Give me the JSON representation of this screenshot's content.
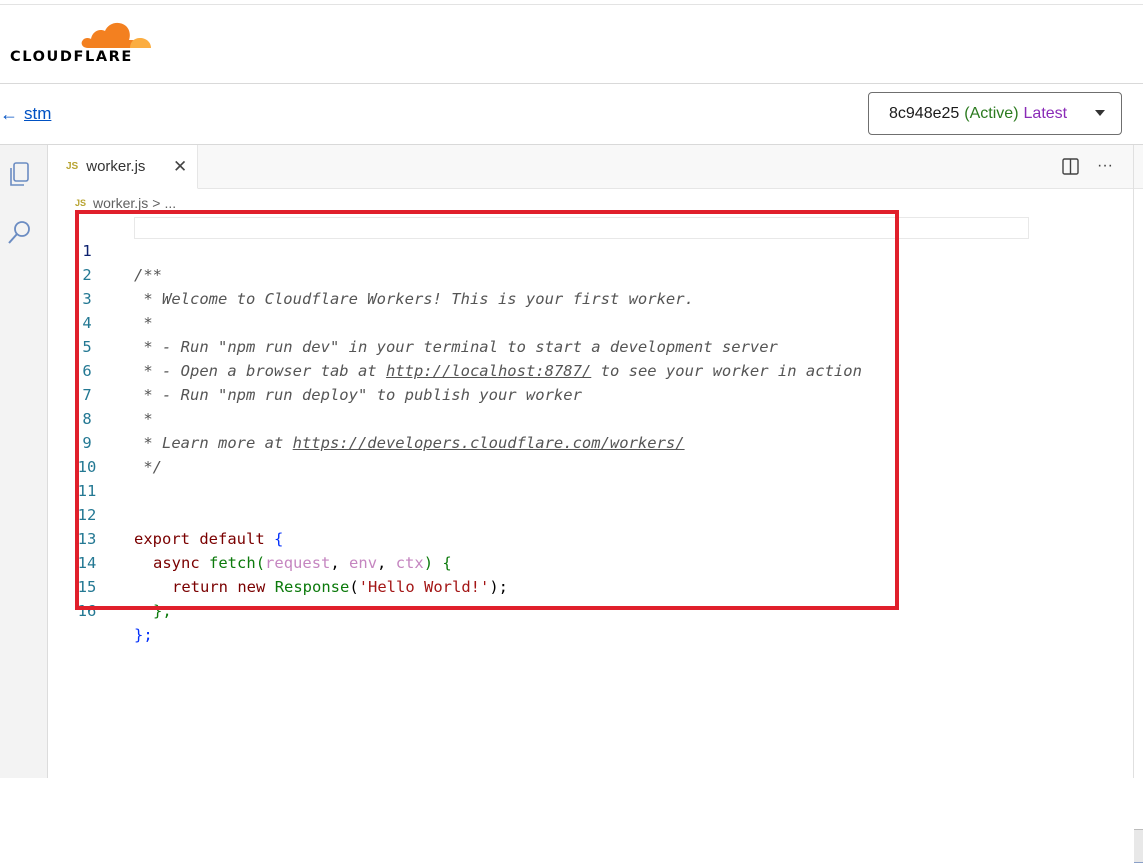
{
  "brand": {
    "name": "CLOUDFLARE"
  },
  "nav": {
    "back_label": "stm",
    "back_icon": "arrow-left-icon"
  },
  "version": {
    "id": "8c948e25",
    "status": "(Active)",
    "tag": "Latest"
  },
  "tabs": [
    {
      "badge": "JS",
      "label": "worker.js"
    }
  ],
  "breadcrumb": {
    "badge": "JS",
    "file": "worker.js",
    "sep": ">",
    "rest": "..."
  },
  "code": {
    "lines": [
      {
        "n": "1",
        "text": "/**"
      },
      {
        "n": "2",
        "text": " * Welcome to Cloudflare Workers! This is your first worker."
      },
      {
        "n": "3",
        "text": " *"
      },
      {
        "n": "4",
        "text": " * - Run \"npm run dev\" in your terminal to start a development server"
      },
      {
        "n": "5",
        "text_pre": " * - Open a browser tab at ",
        "link": "http://localhost:8787/",
        "text_post": " to see your worker in action"
      },
      {
        "n": "6",
        "text": " * - Run \"npm run deploy\" to publish your worker"
      },
      {
        "n": "7",
        "text": " *"
      },
      {
        "n": "8",
        "text_pre": " * Learn more at ",
        "link": "https://developers.cloudflare.com/workers/"
      },
      {
        "n": "9",
        "text": " */"
      },
      {
        "n": "10",
        "text": ""
      },
      {
        "n": "11",
        "text": ""
      },
      {
        "n": "12",
        "kw1": "export",
        "kw2": "default",
        "brace": "{"
      },
      {
        "n": "13",
        "kw": "async",
        "fn": "fetch",
        "p1": "request",
        "p2": "env",
        "p3": "ctx"
      },
      {
        "n": "14",
        "kw1": "return",
        "kw2": "new",
        "type": "Response",
        "str": "'Hello World!'"
      },
      {
        "n": "15",
        "text": "},"
      },
      {
        "n": "16",
        "text": "};"
      }
    ]
  },
  "colors": {
    "highlight": "#e01f2b",
    "accent": "#f38020",
    "link": "#0051c3"
  }
}
